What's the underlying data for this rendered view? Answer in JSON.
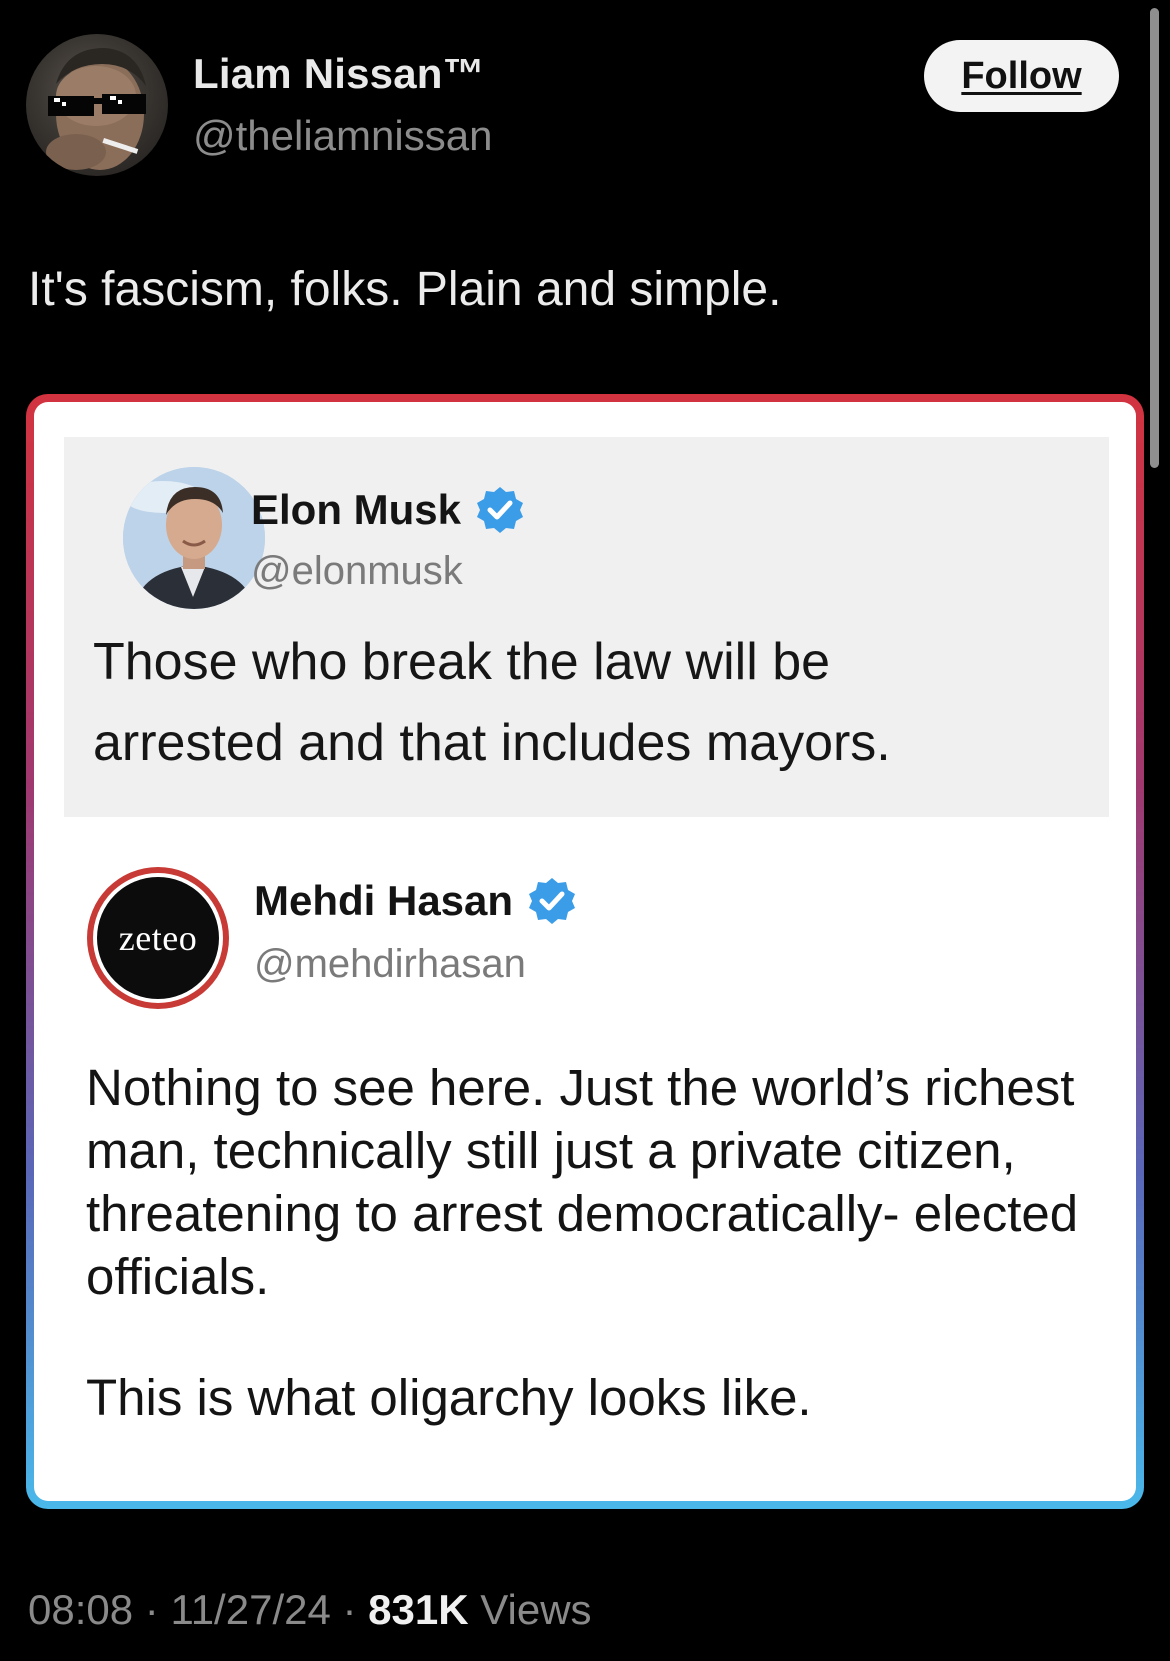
{
  "author": {
    "display_name": "Liam Nissan™",
    "handle": "@theliamnissan"
  },
  "follow_button": {
    "label": "Follow"
  },
  "tweet": {
    "text": "It's fascism, folks. Plain and simple."
  },
  "embedded_image": {
    "border_colors": [
      "#d3333f",
      "#a0386f",
      "#5a67b8",
      "#4ab8ea"
    ],
    "quoted_tweet": {
      "display_name": "Elon Musk",
      "handle": "@elonmusk",
      "text_lines": [
        "Those who break the law will be",
        "arrested and that includes mayors."
      ]
    },
    "reply_tweet": {
      "display_name": "Mehdi Hasan",
      "handle": "@mehdirhasan",
      "avatar_text": "zeteo",
      "paragraph_1": "Nothing to see here. Just the world’s richest man, technically still just a private citizen,  threatening to arrest democratically- elected officials.",
      "paragraph_2": "This is what oligarchy looks like."
    }
  },
  "meta": {
    "time": "08:08",
    "separator": "·",
    "date": "11/27/24",
    "views_count": "831K",
    "views_label": "Views"
  },
  "icons": {
    "verified": "verified-badge-icon",
    "accent_blue": "#3b9ce8"
  }
}
